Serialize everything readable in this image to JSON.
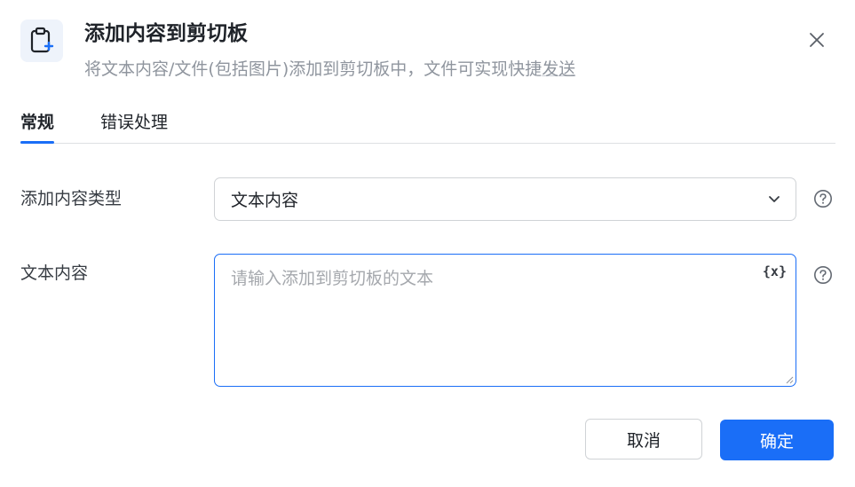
{
  "header": {
    "title": "添加内容到剪切板",
    "subtitle_prefix": "将文本内容/文件(包括图片)添加到剪切板中，文件可实现快捷",
    "subtitle_link": "发送",
    "icon": "clipboard-add-icon"
  },
  "tabs": [
    {
      "label": "常规",
      "active": true
    },
    {
      "label": "错误处理",
      "active": false
    }
  ],
  "form": {
    "content_type": {
      "label": "添加内容类型",
      "value": "文本内容"
    },
    "text_content": {
      "label": "文本内容",
      "placeholder": "请输入添加到剪切板的文本",
      "value": "",
      "variable_icon": "{x}"
    }
  },
  "footer": {
    "cancel_label": "取消",
    "ok_label": "确定"
  },
  "colors": {
    "accent": "#1a6ef7",
    "icon_bg": "#eef3fb",
    "muted_text": "#8f959e"
  }
}
